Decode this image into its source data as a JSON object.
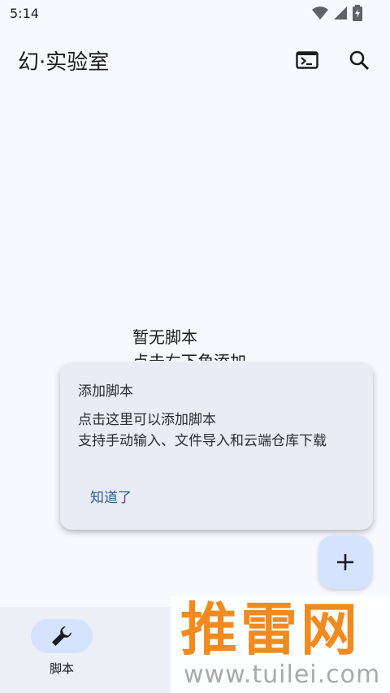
{
  "status_bar": {
    "time": "5:14"
  },
  "app_bar": {
    "title": "幻·实验室",
    "terminal_icon": "terminal-icon",
    "search_icon": "search-icon"
  },
  "empty_state": {
    "line1": "暂无脚本",
    "line2": "点击右下角添加"
  },
  "popup": {
    "title": "添加脚本",
    "body_line1": "点击这里可以添加脚本",
    "body_line2": "支持手动输入、文件导入和云端仓库下载",
    "ok_label": "知道了"
  },
  "fab": {
    "icon": "add-icon"
  },
  "bottom_nav": {
    "items": [
      {
        "label": "脚本",
        "icon": "wrench-icon",
        "selected": true
      }
    ]
  },
  "watermark": {
    "text": "推雷网",
    "url": "www.tuilei.com"
  },
  "colors": {
    "accent": "#2d5d9a",
    "pill": "#d5e3ff",
    "background": "#f8f9ff",
    "watermark": "#f28a1e"
  }
}
